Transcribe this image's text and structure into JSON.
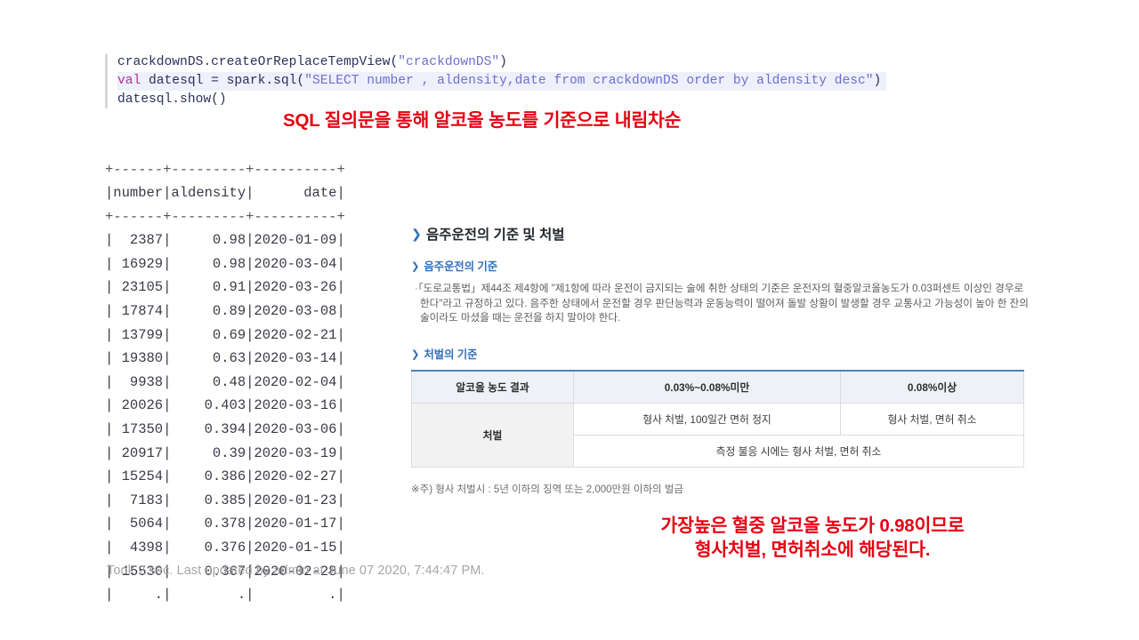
{
  "notebook": {
    "code": {
      "lines": [
        {
          "highlighted": false,
          "tokens": [
            {
              "style": "plain",
              "text": "crackdownDS.createOrReplaceTempView("
            },
            {
              "style": "string",
              "text": "\"crackdownDS\""
            },
            {
              "style": "plain",
              "text": ")"
            }
          ]
        },
        {
          "highlighted": true,
          "tokens": [
            {
              "style": "keyword",
              "text": "val"
            },
            {
              "style": "plain",
              "text": " datesql = spark.sql("
            },
            {
              "style": "string",
              "text": "\"SELECT number , aldensity,date from crackdownDS order by aldensity desc\""
            },
            {
              "style": "plain",
              "text": ")"
            }
          ]
        },
        {
          "highlighted": false,
          "tokens": [
            {
              "style": "plain",
              "text": "datesql.show()"
            }
          ]
        }
      ]
    },
    "output": {
      "rule_top": "+------+---------+----------+",
      "header_row": "|number|aldensity|      date|",
      "rule_mid": "+------+---------+----------+",
      "rows": [
        "|  2387|     0.98|2020-01-09|",
        "| 16929|     0.98|2020-03-04|",
        "| 23105|     0.91|2020-03-26|",
        "| 17874|     0.89|2020-03-08|",
        "| 13799|     0.69|2020-02-21|",
        "| 19380|     0.63|2020-03-14|",
        "|  9938|     0.48|2020-02-04|",
        "| 20026|    0.403|2020-03-16|",
        "| 17350|    0.394|2020-03-06|",
        "| 20917|     0.39|2020-03-19|",
        "| 15254|    0.386|2020-02-27|",
        "|  7183|    0.385|2020-01-23|",
        "|  5064|    0.378|2020-01-17|",
        "|  4398|    0.376|2020-01-15|",
        "| 15530|    0.367|2020-02-28|",
        "|     .|        .|         .|"
      ]
    },
    "status": "Took 2 sec. Last updated by admin at June 07 2020, 7:44:47 PM."
  },
  "annotations": {
    "top": "SQL 질의문을 통해 알코올 농도를 기준으로 내림차순",
    "bottom_line1": "가장높은 혈중 알코올 농도가 0.98이므로",
    "bottom_line2": "형사처벌, 면허취소에 해당된다.",
    "color": "#e60012"
  },
  "reference": {
    "arrow_glyph": "❯",
    "heading_main": "음주운전의 기준 및 처벌",
    "heading_sub1": "음주운전의 기준",
    "paragraph_bullet": "·",
    "paragraph": "「도로교통법」제44조 제4항에 \"제1항에 따라 운전이 금지되는 술에 취한 상태의 기준은 운전자의 혈중알코올농도가 0.03퍼센트 이상인 경우로 한다\"라고 규정하고 있다. 음주한 상태에서 운전할 경우 판단능력과 운동능력이 떨어져 돌발 상황이 발생할 경우 교통사고 가능성이 높아 한 잔의 술이라도 마셨을 때는 운전을 하지 말아야 한다.",
    "heading_sub2": "처벌의 기준",
    "table": {
      "accent_color": "#4a7fbf",
      "headers": [
        "알코올 농도 결과",
        "0.03%~0.08%미만",
        "0.08%이상"
      ],
      "row_label": "처벌",
      "row1": [
        "형사 처벌, 100일간 면허 정지",
        "형사 처벌, 면허 취소"
      ],
      "row2_merged": "측정 불응 시에는 형사 처벌, 면허 취소"
    },
    "footnote": "※주) 형사 처벌시 : 5년 이하의 징역 또는 2,000만원 이하의 벌금"
  }
}
